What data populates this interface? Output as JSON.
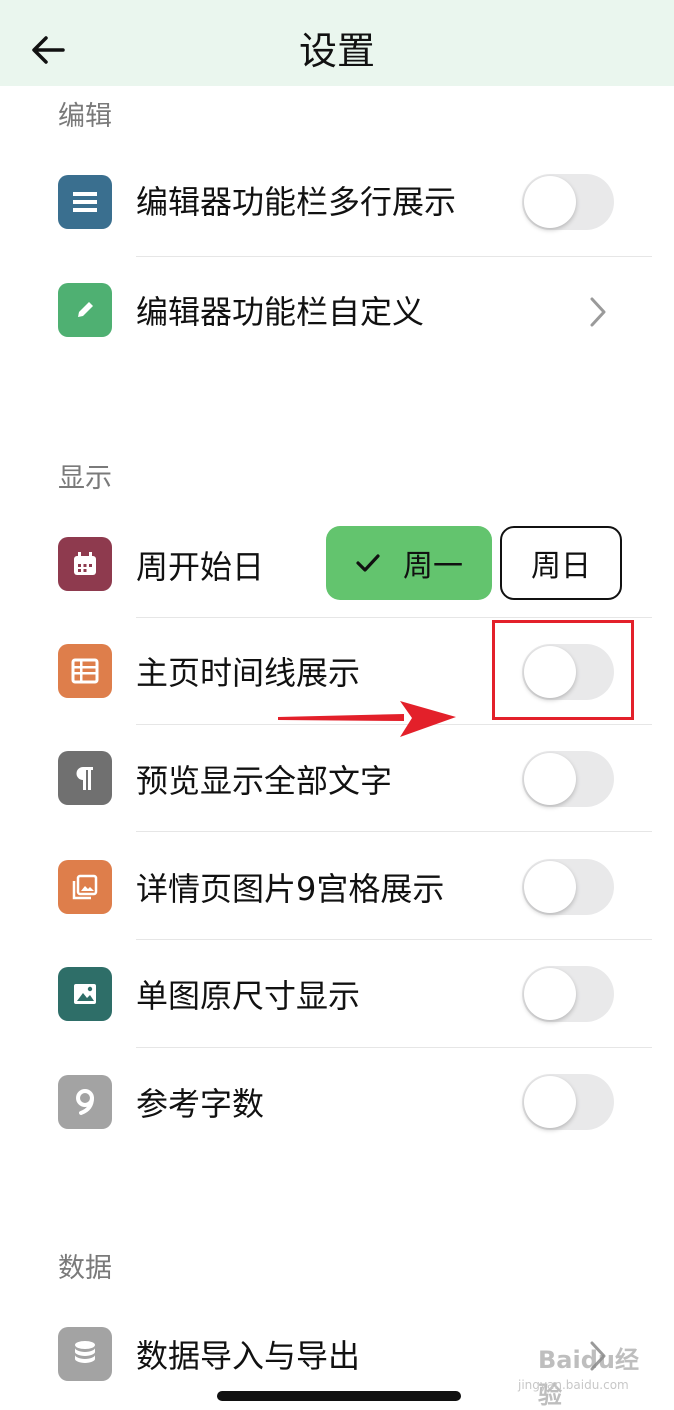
{
  "header": {
    "title": "设置",
    "back_icon": "arrow-left-icon",
    "background": "#eaf6ee"
  },
  "sections": {
    "edit": {
      "title": "编辑",
      "rows": [
        {
          "label": "编辑器功能栏多行展示",
          "icon": "list-icon",
          "icon_color": "#3a6f8f",
          "control": "toggle",
          "on": false
        },
        {
          "label": "编辑器功能栏自定义",
          "icon": "pencil-icon",
          "icon_color": "#4fb072",
          "control": "chevron"
        }
      ]
    },
    "display": {
      "title": "显示",
      "rows": [
        {
          "label": "周开始日",
          "icon": "calendar-icon",
          "icon_color": "#8e3a4e",
          "control": "segmented"
        },
        {
          "label": "主页时间线展示",
          "icon": "table-icon",
          "icon_color": "#de7e4b",
          "control": "toggle",
          "on": false
        },
        {
          "label": "预览显示全部文字",
          "icon": "paragraph-icon",
          "icon_color": "#707070",
          "control": "toggle",
          "on": false
        },
        {
          "label": "详情页图片9宫格展示",
          "icon": "gallery-icon",
          "icon_color": "#de7e4b",
          "control": "toggle",
          "on": false
        },
        {
          "label": "单图原尺寸显示",
          "icon": "image-icon",
          "icon_color": "#2e6e68",
          "control": "toggle",
          "on": false
        },
        {
          "label": "参考字数",
          "icon": "number-nine-icon",
          "icon_color": "#a3a3a3",
          "control": "toggle",
          "on": false
        }
      ],
      "week_start": {
        "options": [
          "周一",
          "周日"
        ],
        "selected": "周一",
        "selected_color": "#63c46e"
      }
    },
    "data": {
      "title": "数据",
      "rows": [
        {
          "label": "数据导入与导出",
          "icon": "database-icon",
          "icon_color": "#a3a3a3",
          "control": "chevron"
        }
      ]
    }
  },
  "annotation": {
    "box_color": "#e3202a",
    "arrow_color": "#e3202a"
  },
  "watermark": {
    "text": "Baidu经验",
    "sub": "jingyan.baidu.com"
  }
}
